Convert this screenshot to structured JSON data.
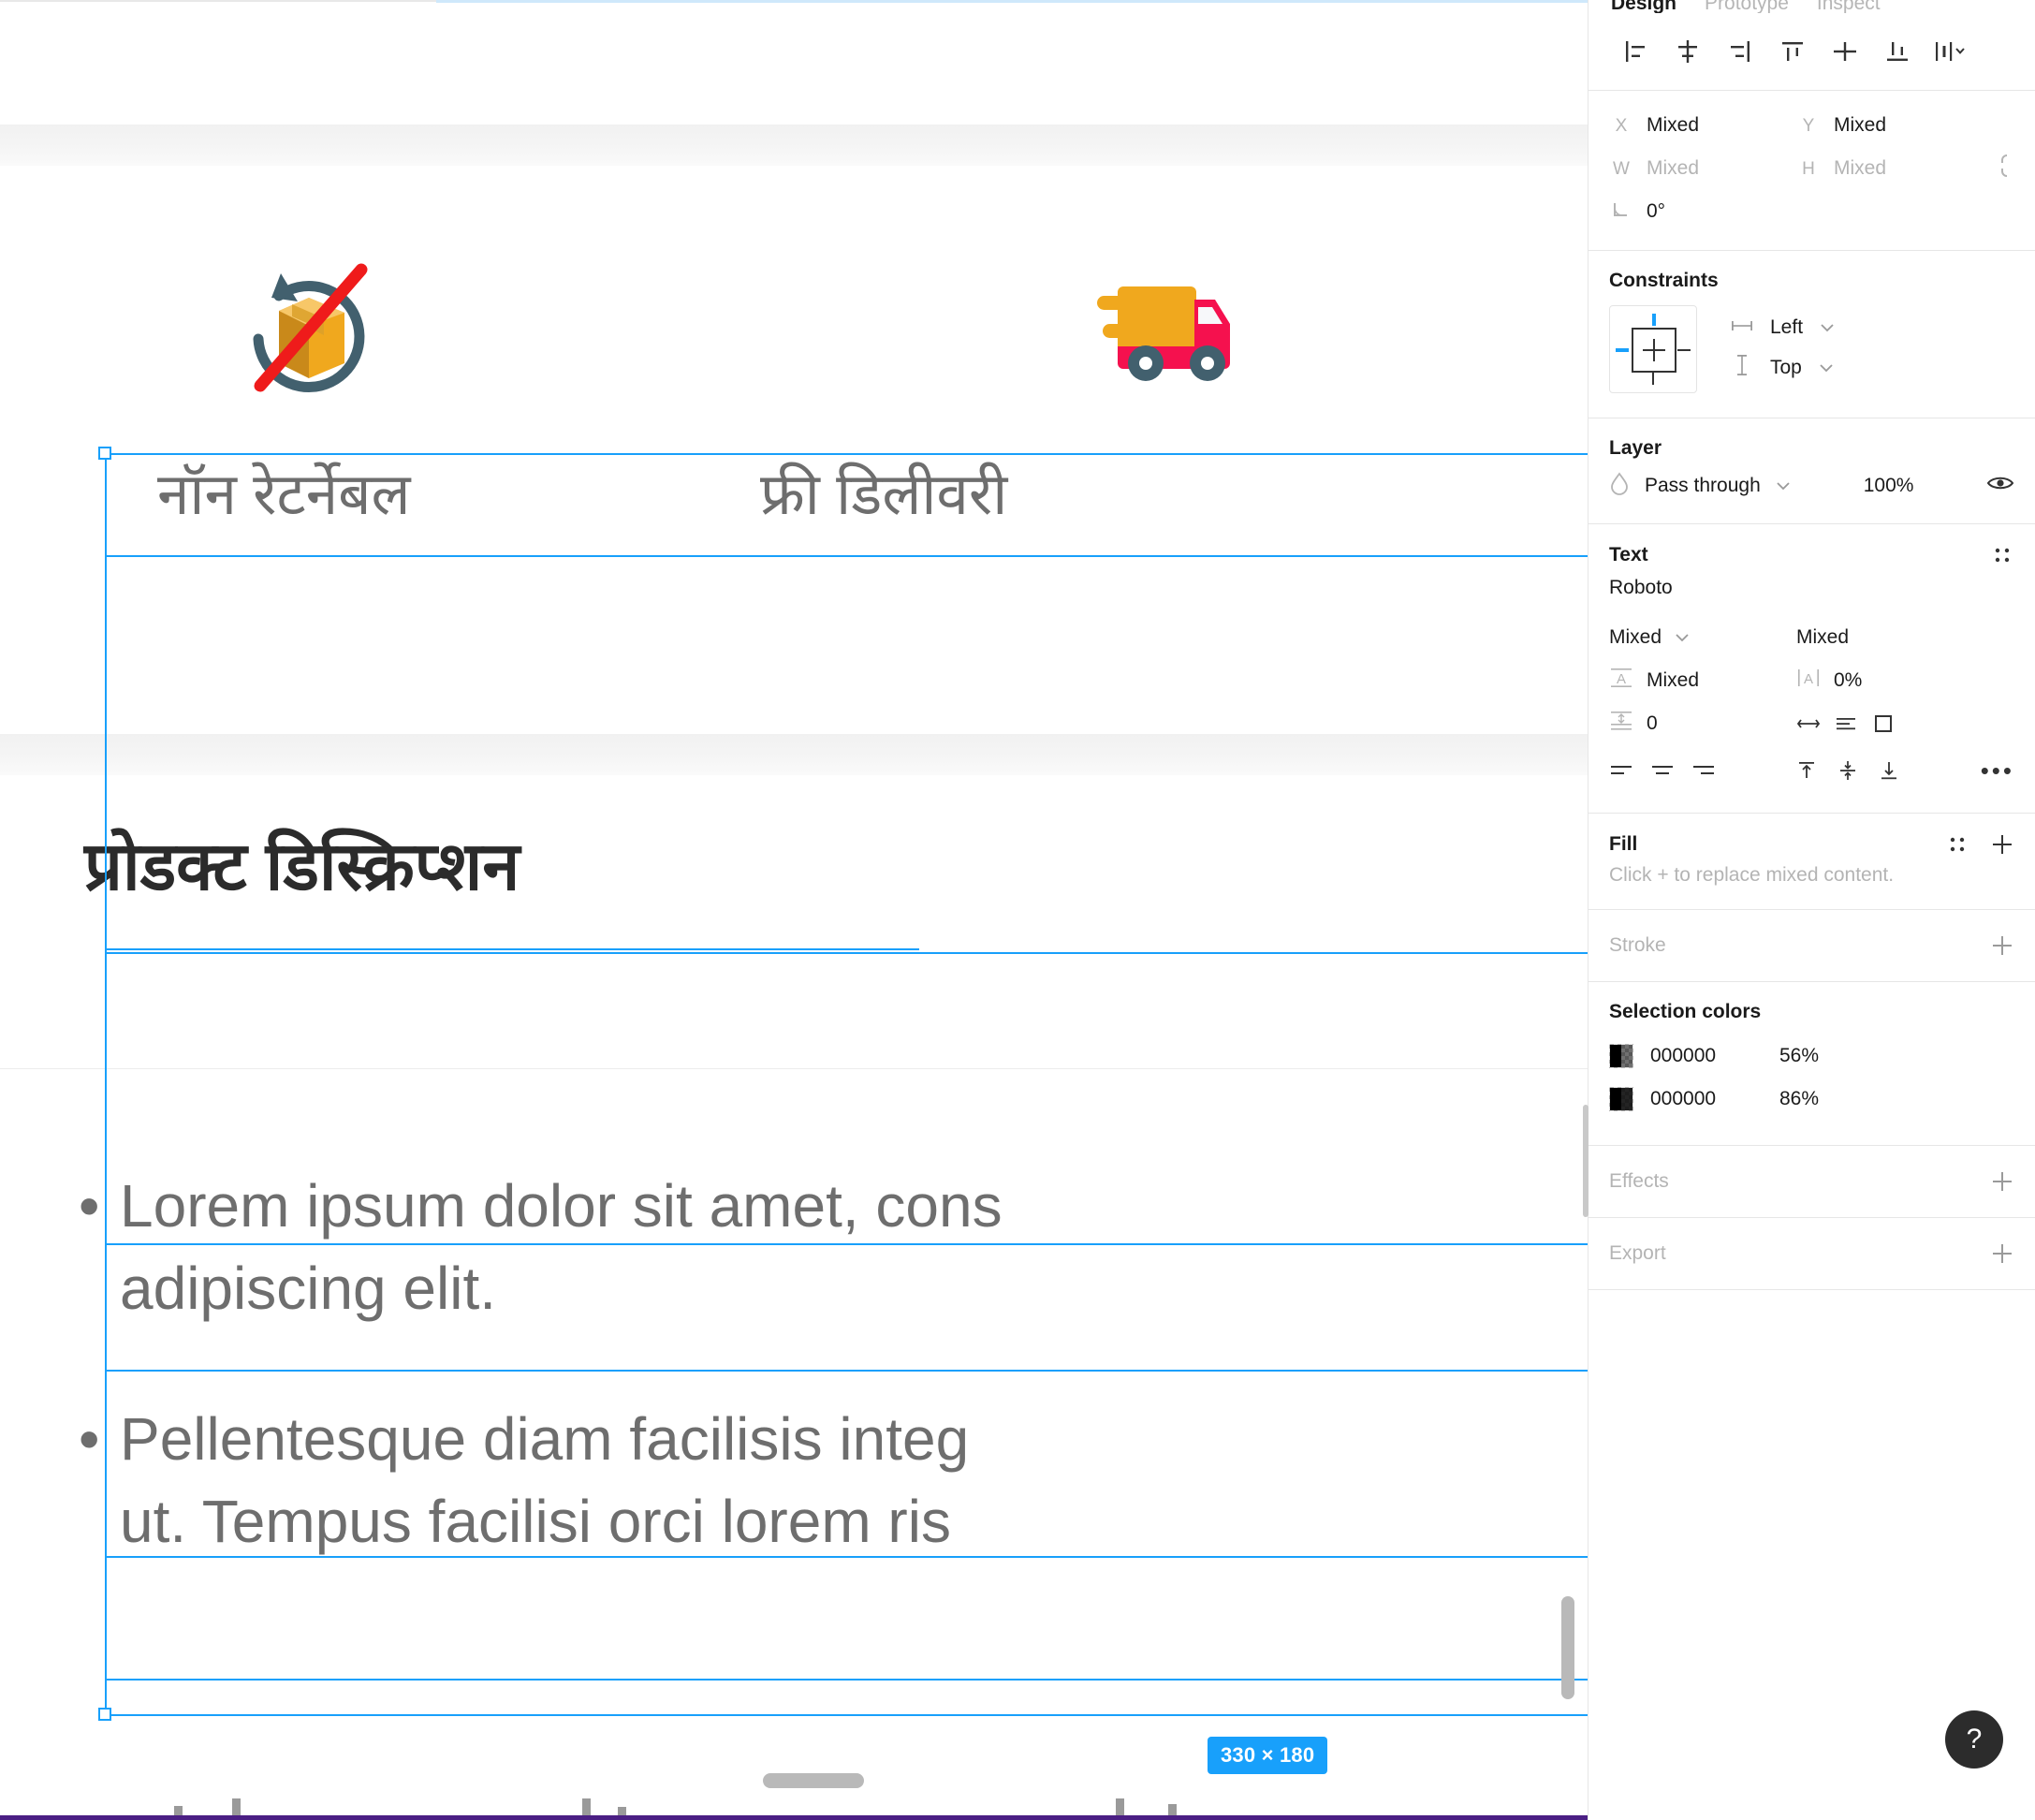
{
  "canvas": {
    "features": [
      {
        "id": "no-return",
        "icon": "no-return-package-icon",
        "label": "नॉन रेटर्नेबल"
      },
      {
        "id": "free-delivery",
        "icon": "delivery-truck-icon",
        "label": "फ्री डिलीवरी"
      }
    ],
    "heading": "प्रोडक्ट डिस्क्रिप्शन",
    "bullets": [
      {
        "dot": "•",
        "line1": "Lorem ipsum dolor sit amet, cons",
        "line2": "adipiscing elit."
      },
      {
        "dot": "•",
        "line1": "Pellentesque diam facilisis integ",
        "line2": "ut. Tempus facilisi orci lorem ris"
      }
    ],
    "selection_size_badge": "330 × 180",
    "selection_color": "#18a0fb"
  },
  "panel": {
    "tabs": [
      {
        "label": "Design",
        "active": true
      },
      {
        "label": "Prototype",
        "active": false
      },
      {
        "label": "Inspect",
        "active": false
      }
    ],
    "align": {
      "buttons": [
        "align-left-icon",
        "align-horizontal-center-icon",
        "align-right-icon",
        "align-top-icon",
        "align-vertical-center-icon",
        "align-bottom-icon",
        "distribute-icon"
      ]
    },
    "transform": {
      "x_label": "X",
      "x_value": "Mixed",
      "y_label": "Y",
      "y_value": "Mixed",
      "w_label": "W",
      "w_value": "Mixed",
      "h_label": "H",
      "h_value": "Mixed",
      "rotation_value": "0°"
    },
    "constraints": {
      "title": "Constraints",
      "horizontal": "Left",
      "vertical": "Top"
    },
    "layer": {
      "title": "Layer",
      "blend_mode": "Pass through",
      "opacity": "100%"
    },
    "text": {
      "title": "Text",
      "font_family": "Roboto",
      "font_style": "Mixed",
      "font_size": "Mixed",
      "line_height": "Mixed",
      "letter_spacing": "0%",
      "paragraph_spacing": "0"
    },
    "fill": {
      "title": "Fill",
      "hint": "Click + to replace mixed content."
    },
    "stroke": {
      "title": "Stroke"
    },
    "selection_colors": {
      "title": "Selection colors",
      "rows": [
        {
          "hex": "000000",
          "opacity": "56%"
        },
        {
          "hex": "000000",
          "opacity": "86%"
        }
      ]
    },
    "effects": {
      "title": "Effects"
    },
    "export": {
      "title": "Export"
    },
    "help_label": "?"
  }
}
